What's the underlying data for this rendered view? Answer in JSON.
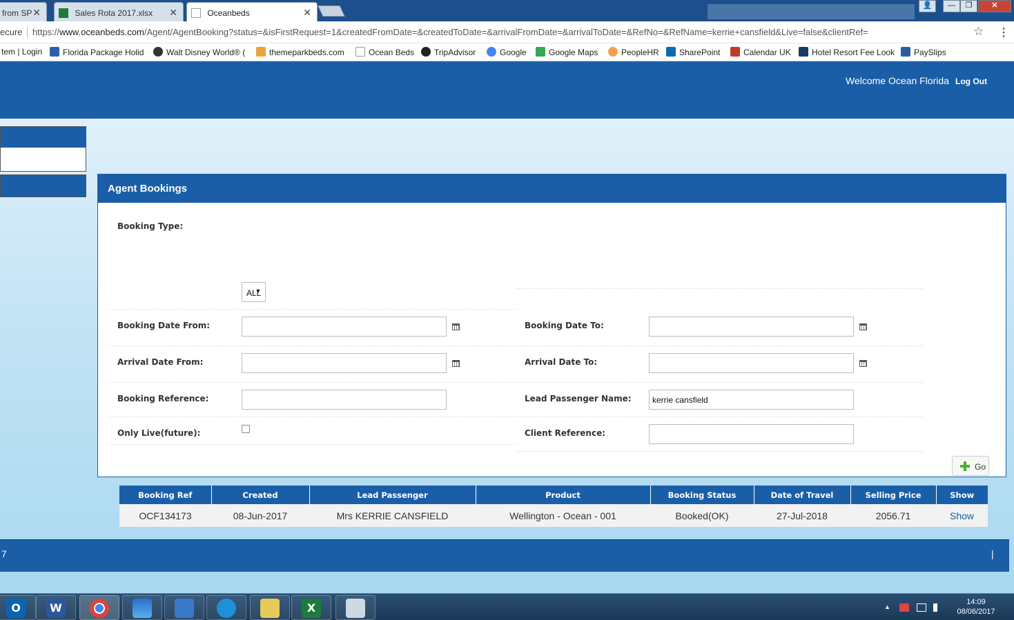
{
  "browser": {
    "tabs": [
      {
        "label": "from SP",
        "close": "✕"
      },
      {
        "label": "Sales Rota 2017.xlsx",
        "close": "✕"
      },
      {
        "label": "Oceanbeds",
        "close": "✕"
      }
    ],
    "window_controls": {
      "user": "👤",
      "minimize": "—",
      "maximize": "❐",
      "close": "✕"
    },
    "security": "ecure",
    "url_scheme": "https://",
    "url_host": "www.oceanbeds.com",
    "url_path": "/Agent/AgentBooking?status=&isFirstRequest=1&createdFromDate=&createdToDate=&arrivalFromDate=&arrivalToDate=&RefNo=&RefName=kerrie+cansfield&Live=false&clientRef=",
    "bookmark_star": "☆",
    "menu_dots": "⋮",
    "bookmarks": [
      {
        "label": "tem | Login",
        "icon": "none"
      },
      {
        "label": "Florida Package Holid",
        "icon": "plane-icon"
      },
      {
        "label": "Walt Disney World® (",
        "icon": "disney-icon"
      },
      {
        "label": "themeparkbeds.com",
        "icon": "tpb-icon"
      },
      {
        "label": "Ocean Beds",
        "icon": "page-icon"
      },
      {
        "label": "TripAdvisor",
        "icon": "owl-icon"
      },
      {
        "label": "Google",
        "icon": "google-icon"
      },
      {
        "label": "Google Maps",
        "icon": "maps-icon"
      },
      {
        "label": "PeopleHR",
        "icon": "peoplehr-icon"
      },
      {
        "label": "SharePoint",
        "icon": "sharepoint-icon"
      },
      {
        "label": "Calendar UK",
        "icon": "calendar-icon"
      },
      {
        "label": "Hotel Resort Fee Look",
        "icon": "r-icon"
      },
      {
        "label": "PaySlips",
        "icon": "bar-chart-icon"
      }
    ]
  },
  "header": {
    "welcome": "Welcome Ocean Florida",
    "logout": "Log Out"
  },
  "panel": {
    "title": "Agent Bookings",
    "booking_type_label": "Booking Type:",
    "booking_type_value": "ALL",
    "booking_date_from_label": "Booking Date From:",
    "booking_date_to_label": "Booking Date To:",
    "arrival_date_from_label": "Arrival Date From:",
    "arrival_date_to_label": "Arrival Date To:",
    "booking_reference_label": "Booking Reference:",
    "lead_passenger_label": "Lead Passenger Name:",
    "lead_passenger_value": "kerrie cansfield",
    "only_live_label": "Only Live(future):",
    "only_live_checked": false,
    "client_reference_label": "Client Reference:",
    "go_label": "Go"
  },
  "results": {
    "columns": [
      "Booking Ref",
      "Created",
      "Lead Passenger",
      "Product",
      "Booking Status",
      "Date of Travel",
      "Selling Price",
      "Show"
    ],
    "rows": [
      {
        "ref": "OCF134173",
        "created": "08-Jun-2017",
        "lead": "Mrs KERRIE CANSFIELD",
        "product": "Wellington - Ocean - 001",
        "status": "Booked(OK)",
        "travel": "27-Jul-2018",
        "price": "2056.71",
        "show": "Show"
      }
    ]
  },
  "footer": {
    "left": "7",
    "right": "|"
  },
  "taskbar": {
    "apps": [
      "O",
      "W",
      "",
      "",
      "",
      "",
      "",
      "X",
      ""
    ],
    "tray_arrow": "▲",
    "time": "14:09",
    "date": "08/06/2017"
  },
  "colors": {
    "brand_blue": "#1a5ea8",
    "link_blue": "#1a5ea8",
    "go_plus": "#4caf2a"
  }
}
